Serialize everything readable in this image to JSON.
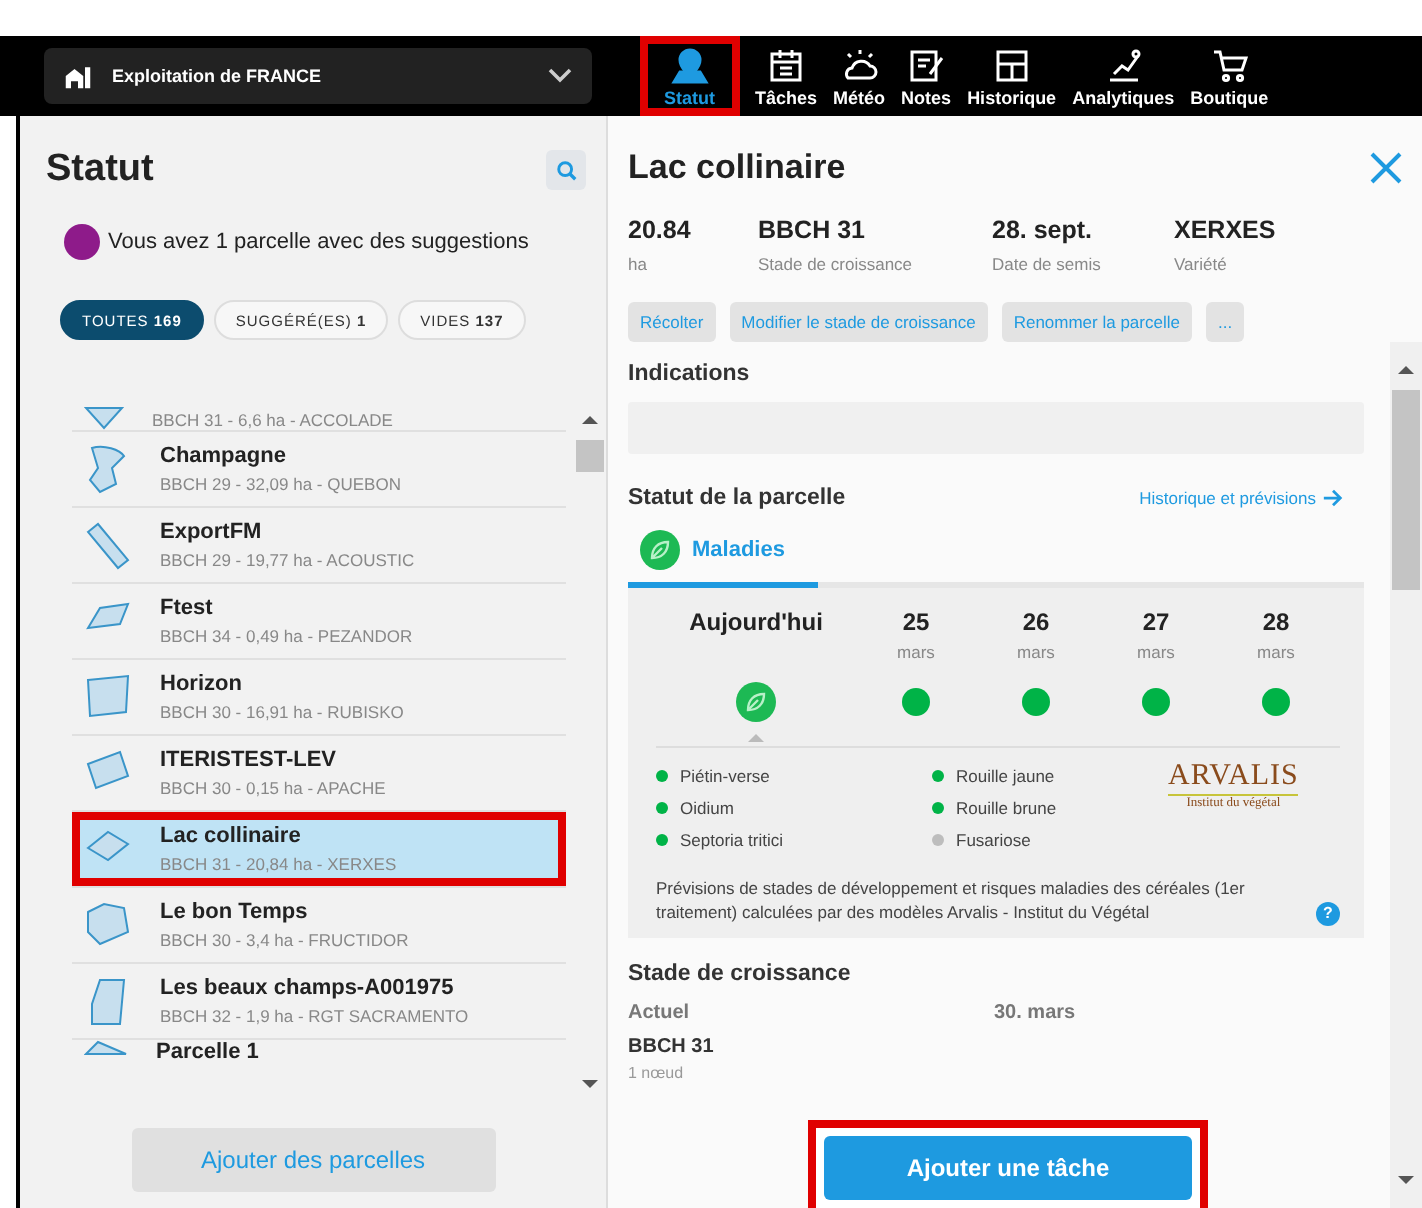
{
  "farm_selector": {
    "label": "Exploitation de FRANCE"
  },
  "nav": [
    {
      "label": "Statut",
      "selected": true,
      "highlighted": true
    },
    {
      "label": "Tâches",
      "selected": false,
      "highlighted": false
    },
    {
      "label": "Météo",
      "selected": false,
      "highlighted": false
    },
    {
      "label": "Notes",
      "selected": false,
      "highlighted": false
    },
    {
      "label": "Historique",
      "selected": false,
      "highlighted": false
    },
    {
      "label": "Analytiques",
      "selected": false,
      "highlighted": false
    },
    {
      "label": "Boutique",
      "selected": false,
      "highlighted": false
    }
  ],
  "sidebar": {
    "title": "Statut",
    "suggestion": "Vous avez 1 parcelle avec des suggestions",
    "filters": [
      {
        "label": "TOUTES",
        "count": "169",
        "selected": true
      },
      {
        "label": "SUGGÉRÉ(ES)",
        "count": "1",
        "selected": false
      },
      {
        "label": "VIDES",
        "count": "137",
        "selected": false
      }
    ],
    "parcels": [
      {
        "details": "BBCH 31 - 6,6 ha - ACCOLADE",
        "selected": false,
        "highlighted": false
      },
      {
        "name": "Champagne",
        "details": "BBCH 29 - 32,09 ha - QUEBON",
        "selected": false,
        "highlighted": false
      },
      {
        "name": "ExportFM",
        "details": "BBCH 29 - 19,77 ha - ACOUSTIC",
        "selected": false,
        "highlighted": false
      },
      {
        "name": "Ftest",
        "details": "BBCH 34 - 0,49 ha - PEZANDOR",
        "selected": false,
        "highlighted": false
      },
      {
        "name": "Horizon",
        "details": "BBCH 30 - 16,91 ha - RUBISKO",
        "selected": false,
        "highlighted": false
      },
      {
        "name": "ITERISTEST-LEV",
        "details": "BBCH 30 - 0,15 ha - APACHE",
        "selected": false,
        "highlighted": false
      },
      {
        "name": "Lac collinaire",
        "details": "BBCH 31 - 20,84 ha - XERXES",
        "selected": true,
        "highlighted": true
      },
      {
        "name": "Le bon Temps",
        "details": "BBCH 30 - 3,4 ha - FRUCTIDOR",
        "selected": false,
        "highlighted": false
      },
      {
        "name": "Les beaux champs-A001975",
        "details": "BBCH 32 - 1,9 ha - RGT SACRAMENTO",
        "selected": false,
        "highlighted": false
      },
      {
        "name": "Parcelle 1",
        "selected": false,
        "highlighted": false
      }
    ],
    "add_button": "Ajouter des parcelles"
  },
  "detail": {
    "title": "Lac collinaire",
    "stats": [
      {
        "value": "20.84",
        "label": "ha"
      },
      {
        "value": "BBCH 31",
        "label": "Stade de croissance"
      },
      {
        "value": "28. sept.",
        "label": "Date de semis"
      },
      {
        "value": "XERXES",
        "label": "Variété"
      }
    ],
    "actions": [
      "Récolter",
      "Modifier le stade de croissance",
      "Renommer la parcelle",
      "..."
    ],
    "indications_title": "Indications",
    "status_title": "Statut de la parcelle",
    "status_link": "Historique et prévisions",
    "tabs": [
      {
        "label": "Maladies",
        "selected": true
      }
    ],
    "days": [
      {
        "day": "Aujourd'hui",
        "kind": "today",
        "color": "#1db954",
        "selected": true
      },
      {
        "day": "25",
        "month": "mars",
        "kind": "forecast",
        "color": "#00b347",
        "selected": false
      },
      {
        "day": "26",
        "month": "mars",
        "kind": "forecast",
        "color": "#00b347",
        "selected": false
      },
      {
        "day": "27",
        "month": "mars",
        "kind": "forecast",
        "color": "#00b347",
        "selected": false
      },
      {
        "day": "28",
        "month": "mars",
        "kind": "forecast",
        "color": "#00b347",
        "selected": false
      }
    ],
    "diseases": [
      {
        "name": "Piétin-verse",
        "color": "#00b347"
      },
      {
        "name": "Oidium",
        "color": "#00b347"
      },
      {
        "name": "Septoria tritici",
        "color": "#00b347"
      },
      {
        "name": "Rouille jaune",
        "color": "#00b347"
      },
      {
        "name": "Rouille brune",
        "color": "#00b347"
      },
      {
        "name": "Fusariose",
        "color": "#bdbdbd"
      }
    ],
    "logo": {
      "name": "ARVALIS",
      "tagline": "Institut du végétal"
    },
    "note": "Prévisions de stades de développement et risques maladies des céréales (1er traitement) calculées par des modèles Arvalis - Institut du Végétal",
    "help": "?",
    "growth_title": "Stade de croissance",
    "growth": [
      {
        "heading": "Actuel",
        "stage": "BBCH 31",
        "desc": "1 nœud"
      },
      {
        "heading": "30. mars"
      }
    ],
    "add_task": {
      "label": "Ajouter une tâche",
      "highlighted": true
    }
  }
}
